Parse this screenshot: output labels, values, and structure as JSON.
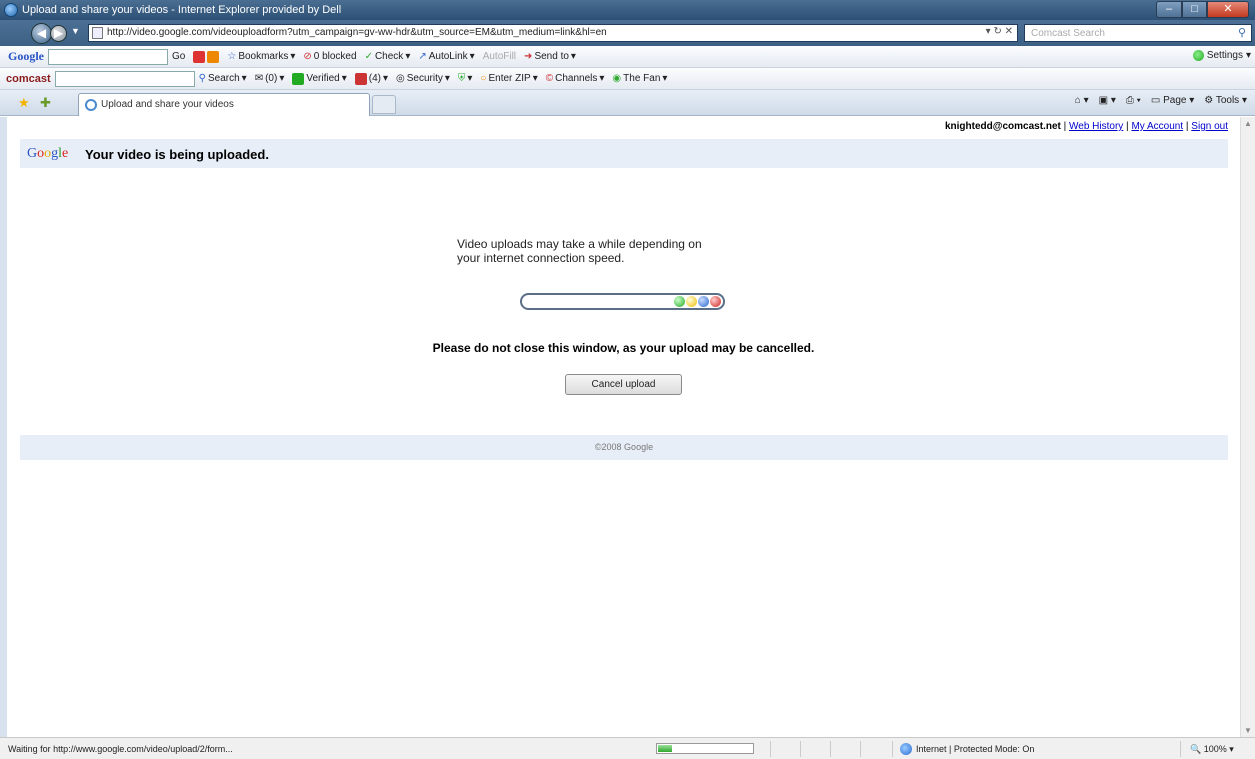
{
  "window": {
    "title": "Upload and share your videos - Internet Explorer provided by Dell"
  },
  "addressbar": {
    "url": "http://video.google.com/videouploadform?utm_campaign=gv-ww-hdr&utm_source=EM&utm_medium=link&hl=en",
    "search_placeholder": "Comcast Search"
  },
  "google_toolbar": {
    "logo": "Google",
    "go_label": "Go",
    "bookmarks_label": "Bookmarks",
    "blocked_label": "0 blocked",
    "check_label": "Check",
    "autolink_label": "AutoLink",
    "autofill_label": "AutoFill",
    "sendto_label": "Send to",
    "settings_label": "Settings"
  },
  "comcast_toolbar": {
    "logo": "comcast",
    "search_label": "Search",
    "mail_label": "(0)",
    "verified_label": "Verified",
    "count_label": "(4)",
    "security_label": "Security",
    "enterzip_label": "Enter ZIP",
    "channels_label": "Channels",
    "thefan_label": "The Fan"
  },
  "tabs": {
    "active_label": "Upload and share your videos"
  },
  "command_bar": {
    "page_label": "Page",
    "tools_label": "Tools"
  },
  "page": {
    "account_email": "knightedd@comcast.net",
    "web_history": "Web History",
    "my_account": "My Account",
    "sign_out": "Sign out",
    "headline": "Your video is being uploaded.",
    "message_line1": "Video uploads may take a while depending on",
    "message_line2": "your internet connection speed.",
    "warning": "Please do not close this window, as your upload may be cancelled.",
    "cancel_button": "Cancel upload",
    "footer": "©2008 Google"
  },
  "statusbar": {
    "text": "Waiting for http://www.google.com/video/upload/2/form...",
    "zone": "Internet | Protected Mode: On",
    "zoom": "100%",
    "load_progress": 0.15
  },
  "colors": {
    "titlebar": "#3a5f86",
    "header_band": "#e8eef7",
    "link": "#0000cc"
  }
}
